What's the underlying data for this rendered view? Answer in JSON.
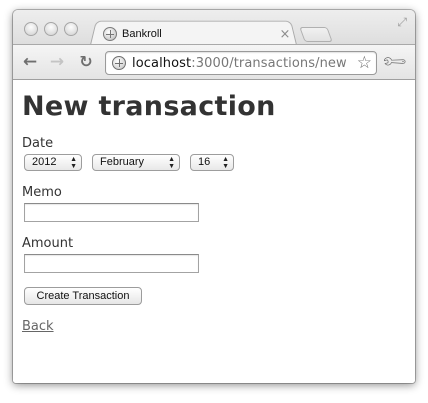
{
  "browser": {
    "tab_title": "Bankroll",
    "tab_close_glyph": "×",
    "url_host": "localhost",
    "url_rest": ":3000/transactions/new",
    "icons": {
      "back": "back-arrow-icon",
      "forward": "forward-arrow-icon",
      "reload": "reload-icon",
      "bookmark": "star-icon",
      "menu": "wrench-icon",
      "favicon": "globe-icon"
    }
  },
  "page": {
    "heading": "New transaction",
    "date_label": "Date",
    "year": "2012",
    "month": "February",
    "day": "16",
    "memo_label": "Memo",
    "memo_value": "",
    "amount_label": "Amount",
    "amount_value": "",
    "submit_label": "Create Transaction",
    "back_link": "Back"
  }
}
